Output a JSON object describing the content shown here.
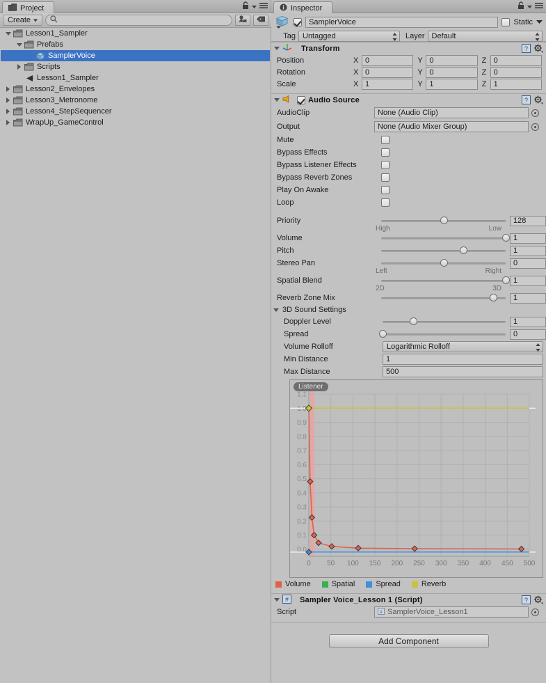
{
  "project_panel": {
    "tab_label": "Project",
    "create_button": "Create",
    "search_placeholder": "",
    "search_value": "",
    "icons": {
      "tab": "folder-icon",
      "search": "search-icon",
      "lock": "lock-icon",
      "menu": "hamburger-menu-icon",
      "filter_type": "filter-by-type-icon",
      "filter_label": "filter-by-label-icon"
    },
    "tree": [
      {
        "label": "Lesson1_Sampler",
        "depth": 0,
        "state": "open",
        "icon": "folder-icon",
        "selected": false
      },
      {
        "label": "Prefabs",
        "depth": 1,
        "state": "open",
        "icon": "folder-icon",
        "selected": false
      },
      {
        "label": "SamplerVoice",
        "depth": 2,
        "state": "leaf",
        "icon": "prefab-icon",
        "selected": true
      },
      {
        "label": "Scripts",
        "depth": 1,
        "state": "closed",
        "icon": "folder-icon",
        "selected": false
      },
      {
        "label": "Lesson1_Sampler",
        "depth": 1,
        "state": "leaf",
        "icon": "scene-icon",
        "selected": false
      },
      {
        "label": "Lesson2_Envelopes",
        "depth": 0,
        "state": "closed",
        "icon": "folder-icon",
        "selected": false
      },
      {
        "label": "Lesson3_Metronome",
        "depth": 0,
        "state": "closed",
        "icon": "folder-icon",
        "selected": false
      },
      {
        "label": "Lesson4_StepSequencer",
        "depth": 0,
        "state": "closed",
        "icon": "folder-icon",
        "selected": false
      },
      {
        "label": "WrapUp_GameControl",
        "depth": 0,
        "state": "closed",
        "icon": "folder-icon",
        "selected": false
      }
    ]
  },
  "inspector": {
    "tab_label": "Inspector",
    "object": {
      "enabled": true,
      "name": "SamplerVoice",
      "static_label": "Static",
      "static_checked": false,
      "tag_label": "Tag",
      "tag_value": "Untagged",
      "layer_label": "Layer",
      "layer_value": "Default"
    },
    "transform": {
      "title": "Transform",
      "expanded": true,
      "rows": [
        {
          "name": "Position",
          "x": "0",
          "y": "0",
          "z": "0"
        },
        {
          "name": "Rotation",
          "x": "0",
          "y": "0",
          "z": "0"
        },
        {
          "name": "Scale",
          "x": "1",
          "y": "1",
          "z": "1"
        }
      ],
      "axis_labels": [
        "X",
        "Y",
        "Z"
      ]
    },
    "audio_source": {
      "title": "Audio Source",
      "expanded": true,
      "enabled": true,
      "audioclip_label": "AudioClip",
      "audioclip_value": "None (Audio Clip)",
      "output_label": "Output",
      "output_value": "None (Audio Mixer Group)",
      "toggles": [
        {
          "label": "Mute",
          "checked": false
        },
        {
          "label": "Bypass Effects",
          "checked": false
        },
        {
          "label": "Bypass Listener Effects",
          "checked": false
        },
        {
          "label": "Bypass Reverb Zones",
          "checked": false
        },
        {
          "label": "Play On Awake",
          "checked": false
        },
        {
          "label": "Loop",
          "checked": false
        }
      ],
      "sliders": [
        {
          "label": "Priority",
          "value": "128",
          "fill": 0.5,
          "left_end": "High",
          "right_end": "Low"
        },
        {
          "label": "Volume",
          "value": "1",
          "fill": 1.0,
          "left_end": "",
          "right_end": ""
        },
        {
          "label": "Pitch",
          "value": "1",
          "fill": 0.66,
          "left_end": "",
          "right_end": ""
        },
        {
          "label": "Stereo Pan",
          "value": "0",
          "fill": 0.5,
          "left_end": "Left",
          "right_end": "Right"
        },
        {
          "label": "Spatial Blend",
          "value": "1",
          "fill": 1.0,
          "left_end": "2D",
          "right_end": "3D"
        },
        {
          "label": "Reverb Zone Mix",
          "value": "1",
          "fill": 0.9,
          "left_end": "",
          "right_end": ""
        }
      ],
      "threed": {
        "title": "3D Sound Settings",
        "expanded": true,
        "doppler": {
          "label": "Doppler Level",
          "value": "1",
          "fill": 0.25
        },
        "spread": {
          "label": "Spread",
          "value": "0",
          "fill": 0.0
        },
        "rolloff": {
          "label": "Volume Rolloff",
          "value": "Logarithmic Rolloff"
        },
        "min_distance": {
          "label": "Min Distance",
          "value": "1"
        },
        "max_distance": {
          "label": "Max Distance",
          "value": "500"
        }
      }
    },
    "script_component": {
      "title": "Sampler Voice_Lesson 1 (Script)",
      "expanded": true,
      "script_label": "Script",
      "script_value": "SamplerVoice_Lesson1"
    },
    "add_component_button": "Add Component",
    "icons": {
      "lock": "lock-icon",
      "menu": "hamburger-menu-icon",
      "help": "help-book-icon",
      "gear": "gear-icon",
      "transform": "transform-axis-icon",
      "audio": "speaker-icon",
      "script": "csharp-script-icon"
    }
  },
  "chart_data": {
    "type": "line",
    "title": "",
    "annotation": "Listener",
    "xlabel": "",
    "ylabel": "",
    "xlim": [
      0,
      500
    ],
    "ylim": [
      -0.05,
      1.12
    ],
    "xticks": [
      0,
      50,
      100,
      150,
      200,
      250,
      300,
      350,
      400,
      450,
      500
    ],
    "yticks": [
      "1.1",
      "1.0",
      "0.9",
      "0.8",
      "0.7",
      "0.6",
      "0.5",
      "0.4",
      "0.3",
      "0.2",
      "0.1",
      "0.0"
    ],
    "grid": true,
    "legend_position": "below",
    "legend": [
      "Volume",
      "Spatial",
      "Spread",
      "Reverb"
    ],
    "colors": {
      "volume": "#e0614a",
      "spatial": "#36b34a",
      "spread": "#3d8fe0",
      "reverb": "#c9c23d",
      "min_distance_band": "#e8a3a0"
    },
    "series": [
      {
        "name": "Volume",
        "color": "#e0614a",
        "x": [
          0,
          3,
          7,
          12,
          22,
          52,
          112,
          240,
          482
        ],
        "y": [
          1.0,
          0.48,
          0.225,
          0.1,
          0.045,
          0.02,
          0.008,
          0.004,
          0.002
        ]
      },
      {
        "name": "Spatial",
        "color": "#36b34a",
        "x": [
          0,
          500
        ],
        "y": [
          1.0,
          1.0
        ]
      },
      {
        "name": "Spread",
        "color": "#3d8fe0",
        "x": [
          0,
          500
        ],
        "y": [
          -0.02,
          -0.02
        ]
      },
      {
        "name": "Reverb",
        "color": "#c9c23d",
        "x": [
          0,
          500
        ],
        "y": [
          1.0,
          1.0
        ]
      }
    ]
  }
}
